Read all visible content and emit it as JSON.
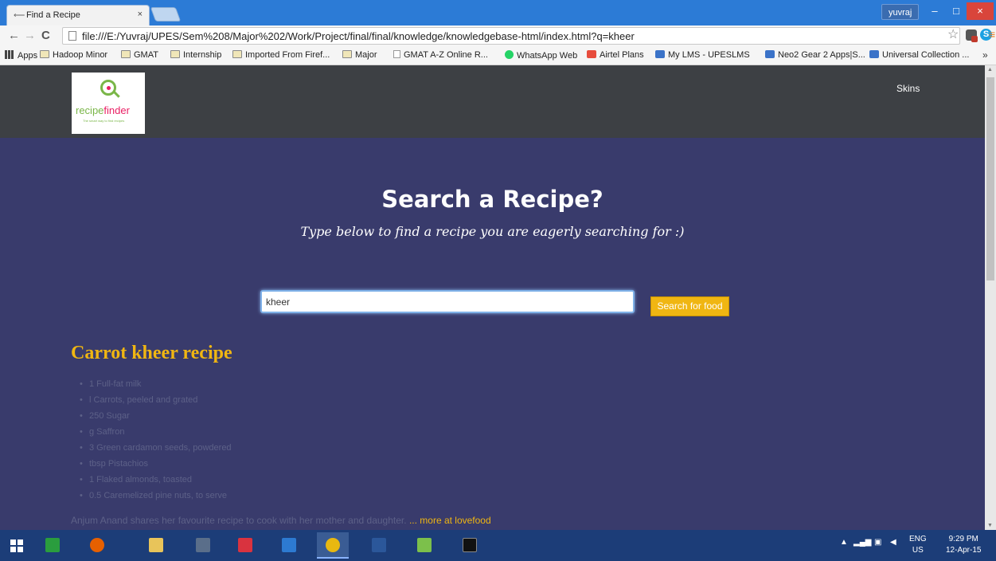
{
  "browser": {
    "tab_title": "Find a Recipe",
    "tab_close": "×",
    "user": "yuvraj",
    "url": "file:///E:/Yuvraj/UPES/Sem%208/Major%202/Work/Project/final/final/knowledge/knowledgebase-html/index.html?q=kheer",
    "window_controls": {
      "minimize": "–",
      "maximize": "□",
      "close": "×"
    },
    "nav": {
      "back": "←",
      "forward": "→",
      "reload": "C"
    },
    "star": "☆",
    "menu": "≡",
    "skype": "S"
  },
  "bookmarks": {
    "items": [
      {
        "label": "Apps",
        "icon": "apps-grid-icon"
      },
      {
        "label": "Hadoop Minor",
        "icon": "folder-icon"
      },
      {
        "label": "GMAT",
        "icon": "folder-icon"
      },
      {
        "label": "Internship",
        "icon": "folder-icon"
      },
      {
        "label": "Imported From Firef...",
        "icon": "folder-icon"
      },
      {
        "label": "Major",
        "icon": "folder-icon"
      },
      {
        "label": "GMAT A-Z Online R...",
        "icon": "page-icon"
      },
      {
        "label": "WhatsApp Web",
        "icon": "whatsapp-icon"
      },
      {
        "label": "Airtel Plans",
        "icon": "airtel-icon"
      },
      {
        "label": "My LMS - UPESLMS",
        "icon": "lms-icon"
      },
      {
        "label": "Neo2 Gear 2 Apps|S...",
        "icon": "neo2-icon"
      },
      {
        "label": "Universal Collection ...",
        "icon": "universal-icon"
      }
    ],
    "more": "»"
  },
  "site": {
    "logo": {
      "word1": "recipe",
      "word2": "finder",
      "tagline": "The smart way to find recipes"
    },
    "nav_skins": "Skins"
  },
  "hero": {
    "title": "Search a Recipe?",
    "subtitle": "Type below to find a recipe you are eagerly searching for :)"
  },
  "search": {
    "value": "kheer",
    "button": "Search for food"
  },
  "result": {
    "title": "Carrot kheer recipe",
    "ingredients": [
      "1 Full-fat milk",
      "l Carrots, peeled and grated",
      "250 Sugar",
      "g Saffron",
      "3 Green cardamon seeds, powdered",
      "tbsp Pistachios",
      "1 Flaked almonds, toasted",
      "0.5 Caremelized pine nuts, to serve"
    ],
    "description": "Anjum Anand shares her favourite recipe to cook with her mother and daughter.",
    "more_link": "... more at lovefood"
  },
  "taskbar": {
    "apps": [
      "start-icon",
      "store-icon",
      "firefox-icon",
      "file-explorer-icon",
      "app-icon",
      "vivaldi-icon",
      "remote-icon",
      "chrome-icon",
      "word-icon",
      "notepad-icon",
      "cmd-icon"
    ],
    "tray_arrow": "▲",
    "lang_line1": "ENG",
    "lang_line2": "US",
    "time": "9:29 PM",
    "date": "12-Apr-15"
  },
  "colors": {
    "page_bg": "#393b6c",
    "header_bg": "#3d4044",
    "accent": "#f0b612",
    "muted_text": "#5d6188",
    "titlebar": "#2c7bd6",
    "taskbar": "#1c3d78"
  }
}
